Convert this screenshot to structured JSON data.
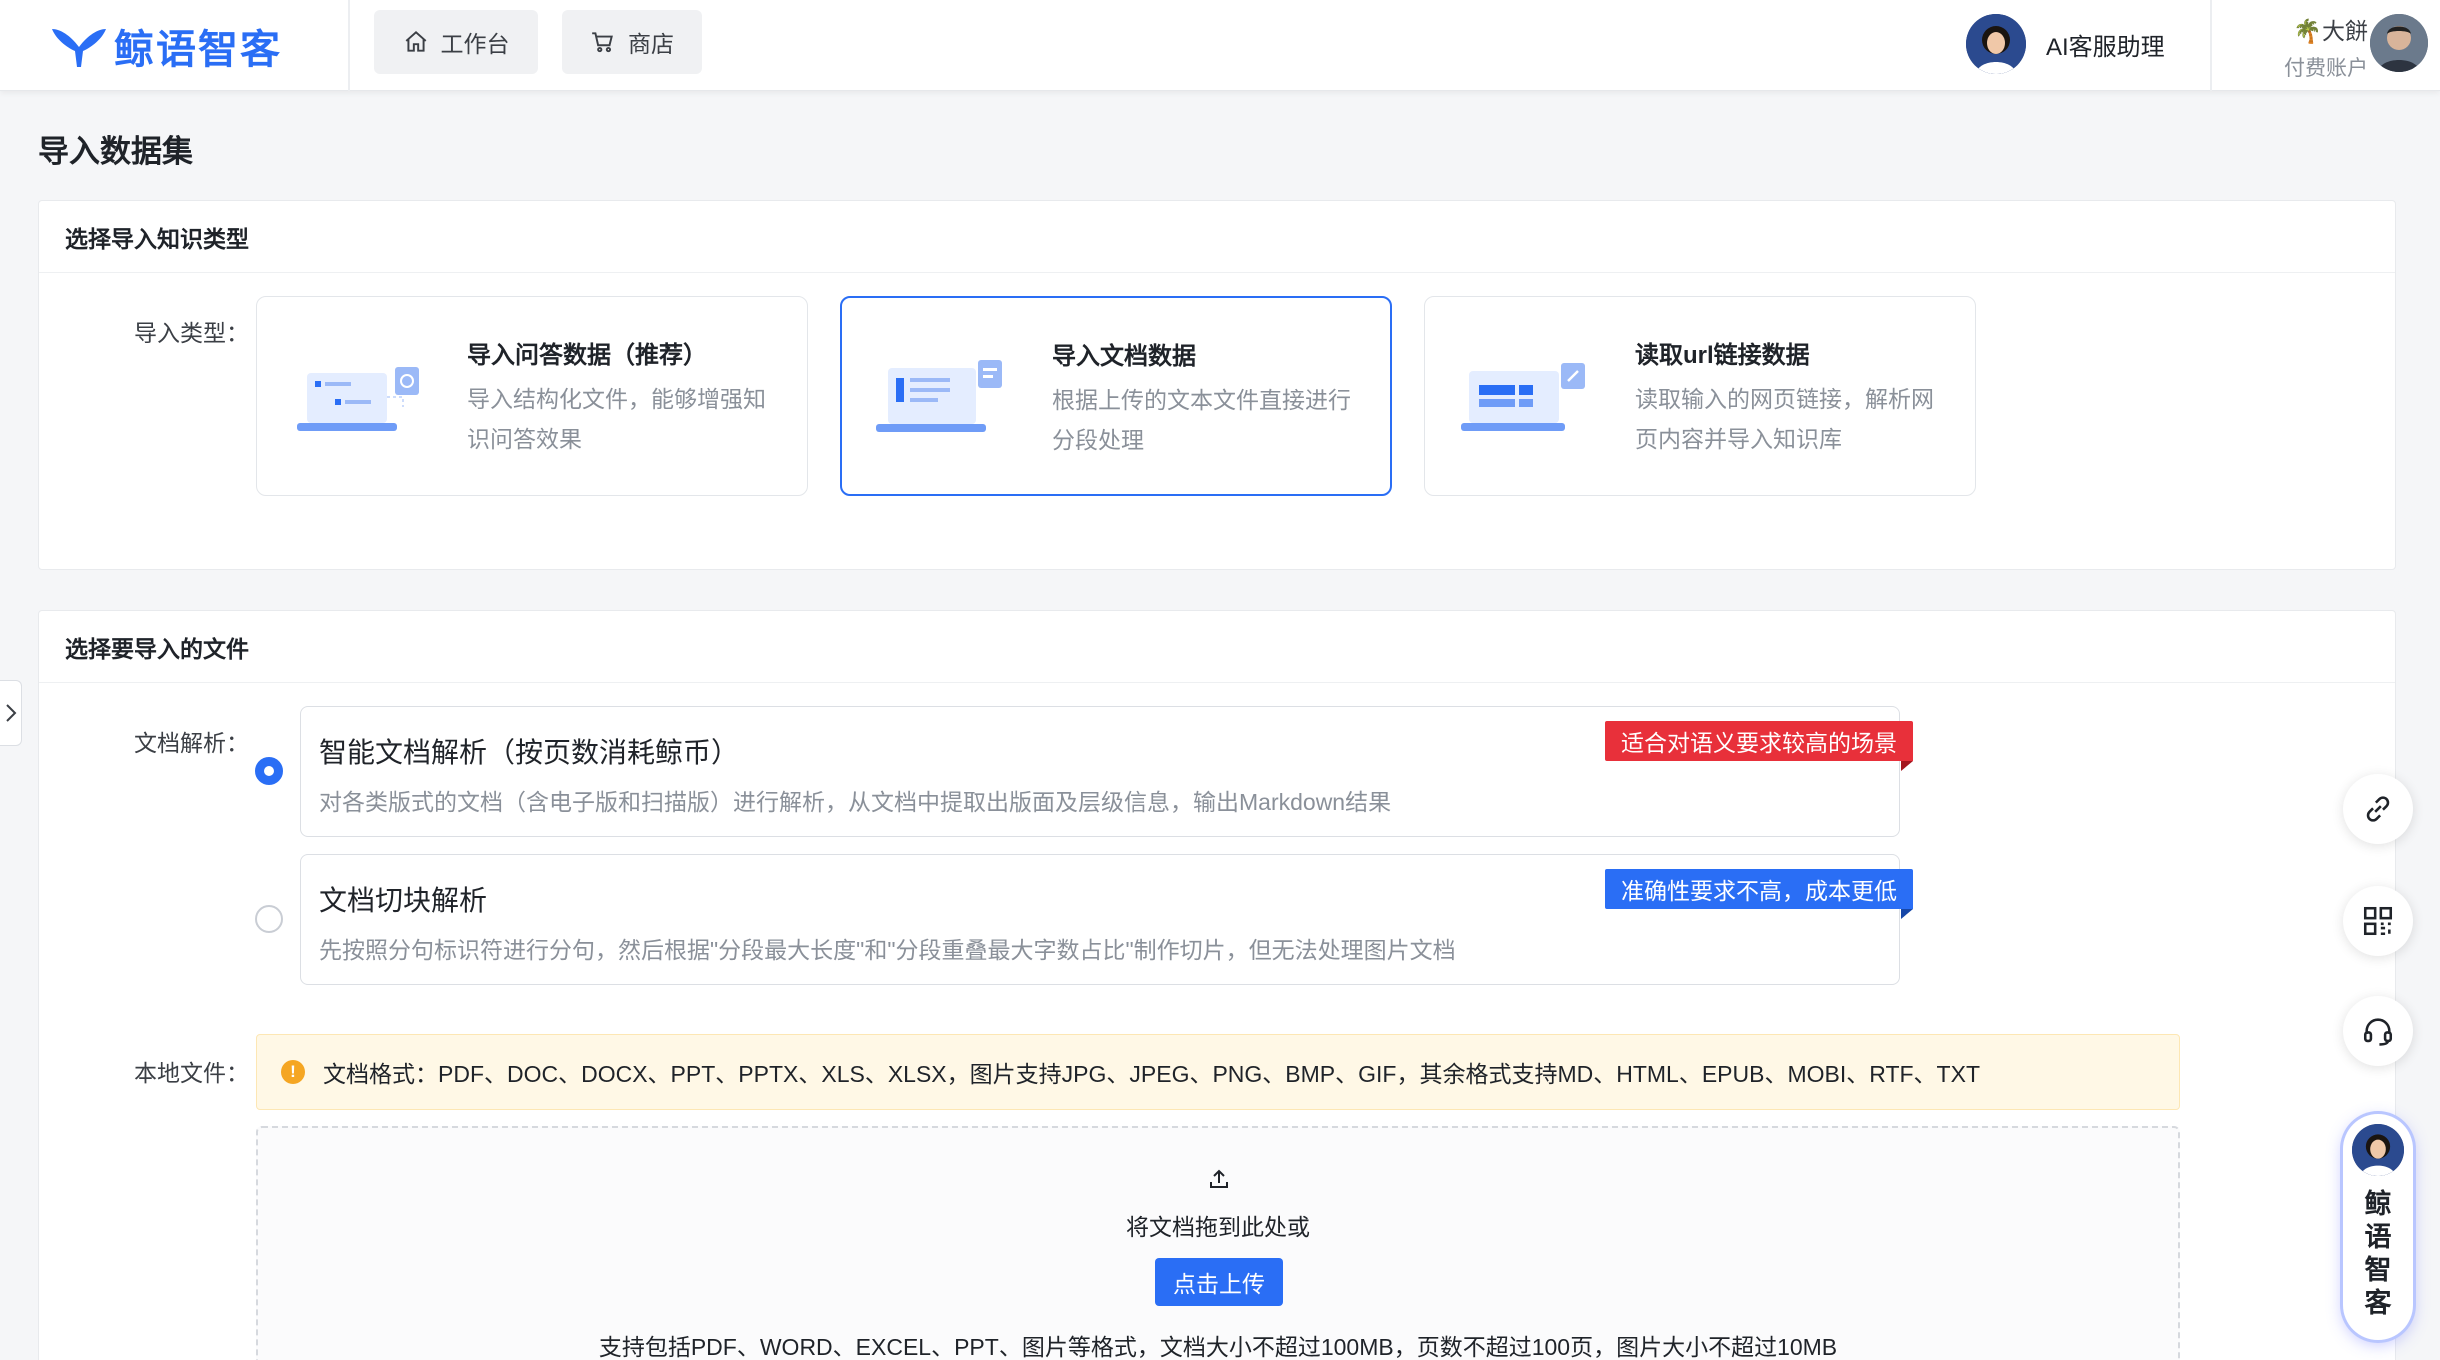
{
  "header": {
    "logo_text": "鲸语智客",
    "nav": [
      {
        "label": "工作台",
        "icon": "home-icon"
      },
      {
        "label": "商店",
        "icon": "cart-icon"
      }
    ],
    "assistant_label": "AI客服助理",
    "user_name": "🌴大餅",
    "user_plan": "付费账户"
  },
  "page": {
    "title": "导入数据集"
  },
  "import_type_section": {
    "header": "选择导入知识类型",
    "label": "导入类型：",
    "options": [
      {
        "title": "导入问答数据（推荐）",
        "desc": "导入结构化文件，能够增强知识问答效果",
        "selected": false
      },
      {
        "title": "导入文档数据",
        "desc": "根据上传的文本文件直接进行分段处理",
        "selected": true
      },
      {
        "title": "读取url链接数据",
        "desc": "读取输入的网页链接，解析网页内容并导入知识库",
        "selected": false
      }
    ]
  },
  "file_section": {
    "header": "选择要导入的文件",
    "parse_label": "文档解析：",
    "parse_options": [
      {
        "title": "智能文档解析（按页数消耗鲸币）",
        "desc": "对各类版式的文档（含电子版和扫描版）进行解析，从文档中提取出版面及层级信息，输出Markdown结果",
        "tag": "适合对语义要求较高的场景",
        "selected": true
      },
      {
        "title": "文档切块解析",
        "desc": "先按照分句标识符进行分句，然后根据\"分段最大长度\"和\"分段重叠最大字数占比\"制作切片，但无法处理图片文档",
        "tag": "准确性要求不高，成本更低",
        "selected": false
      }
    ],
    "local_label": "本地文件：",
    "format_notice": "文档格式：PDF、DOC、DOCX、PPT、PPTX、XLS、XLSX，图片支持JPG、JPEG、PNG、BMP、GIF，其余格式支持MD、HTML、EPUB、MOBI、RTF、TXT",
    "dropzone": {
      "hint": "将文档拖到此处或",
      "button": "点击上传",
      "support": "支持包括PDF、WORD、EXCEL、PPT、图片等格式，文档大小不超过100MB，页数不超过100页，图片大小不超过10MB"
    }
  },
  "floating": {
    "brand_chars": [
      "鲸",
      "语",
      "智",
      "客"
    ]
  },
  "colors": {
    "accent": "#2a6ef5",
    "tag_red": "#e8303a",
    "notice_bg": "#fff8e6"
  }
}
